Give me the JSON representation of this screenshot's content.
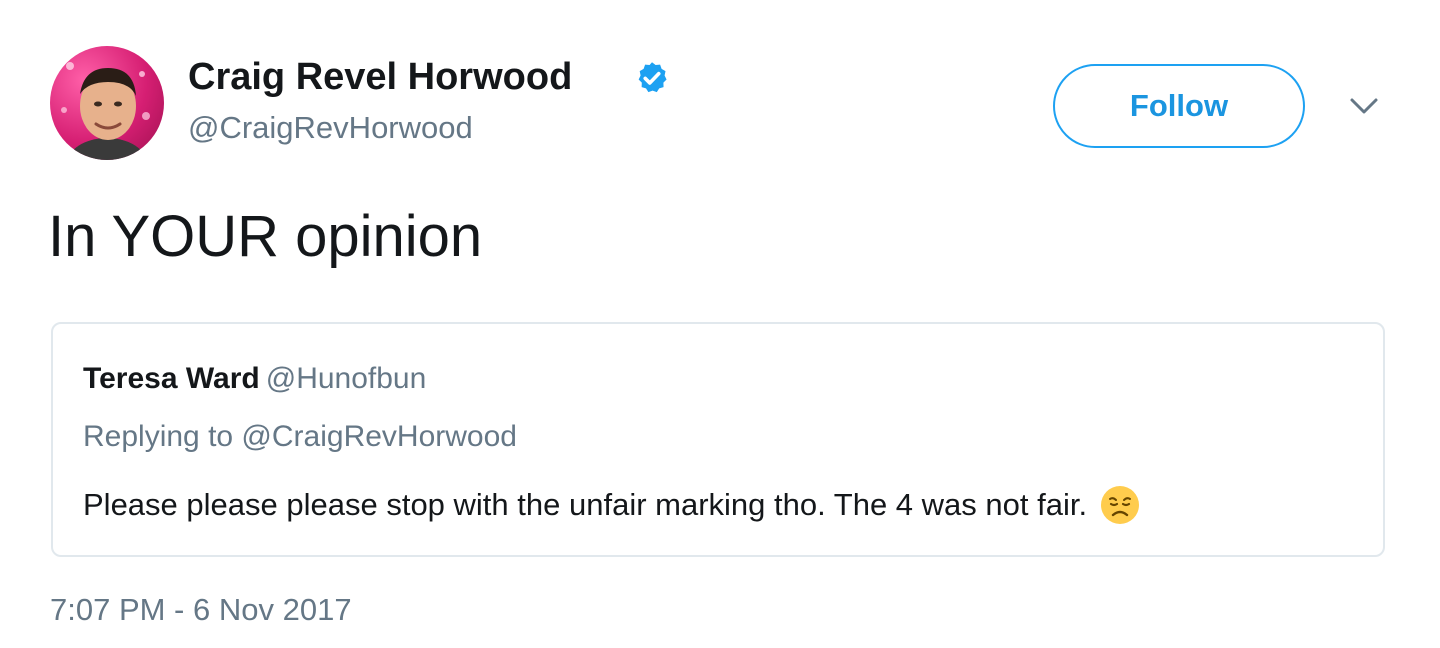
{
  "author": {
    "display_name": "Craig Revel Horwood",
    "handle": "@CraigRevHorwood",
    "verified": true,
    "avatar_icon": "profile-photo"
  },
  "follow_label": "Follow",
  "menu_icon": "chevron-down-icon",
  "tweet_text": "In YOUR opinion",
  "quoted_tweet": {
    "display_name": "Teresa Ward",
    "handle": "@Hunofbun",
    "replying_to": "Replying to @CraigRevHorwood",
    "text": "Please please please stop with the unfair marking tho. The 4 was not fair.",
    "emoji_icon": "disappointed-face-icon"
  },
  "timestamp": "7:07 PM - 6 Nov 2017",
  "colors": {
    "brand_blue": "#1da1f2",
    "follow_text": "#1b95e0",
    "secondary_text": "#657786",
    "border": "#e1e8ed",
    "primary_text": "#14171a"
  }
}
